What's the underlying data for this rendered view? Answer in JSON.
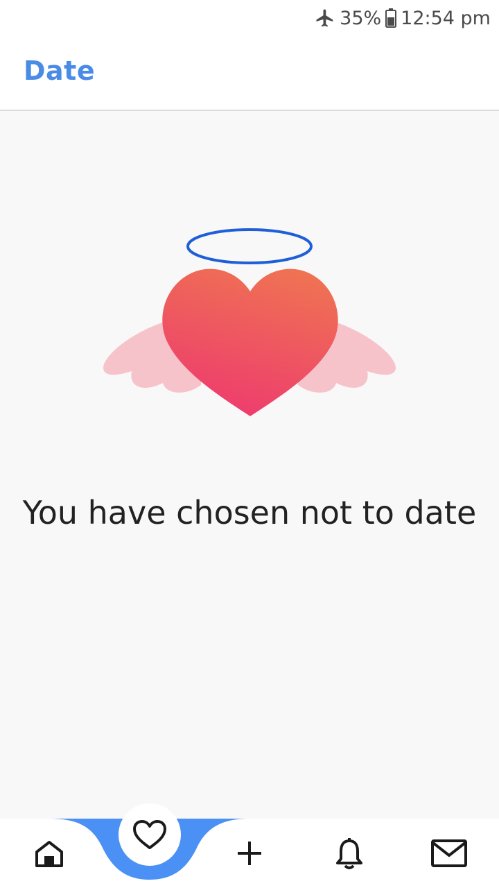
{
  "status_bar": {
    "airplane_icon": "airplane-icon",
    "battery_percent": "35%",
    "battery_icon": "battery-icon",
    "time": "12:54 pm"
  },
  "app_bar": {
    "title": "Date"
  },
  "main": {
    "illustration_icon": "angel-heart-icon",
    "message": "You have chosen not to date"
  },
  "bottom_nav": {
    "items": [
      {
        "icon": "home-icon"
      },
      {
        "icon": "heart-icon",
        "active": true
      },
      {
        "icon": "plus-icon"
      },
      {
        "icon": "bell-icon"
      },
      {
        "icon": "mail-icon"
      }
    ]
  },
  "colors": {
    "accent": "#4a8be6",
    "nav_active": "#4a90f5",
    "heart_top": "#ef7253",
    "heart_bottom": "#ee3b6e",
    "wings": "#f7c3cb",
    "halo": "#1e5fd8"
  }
}
